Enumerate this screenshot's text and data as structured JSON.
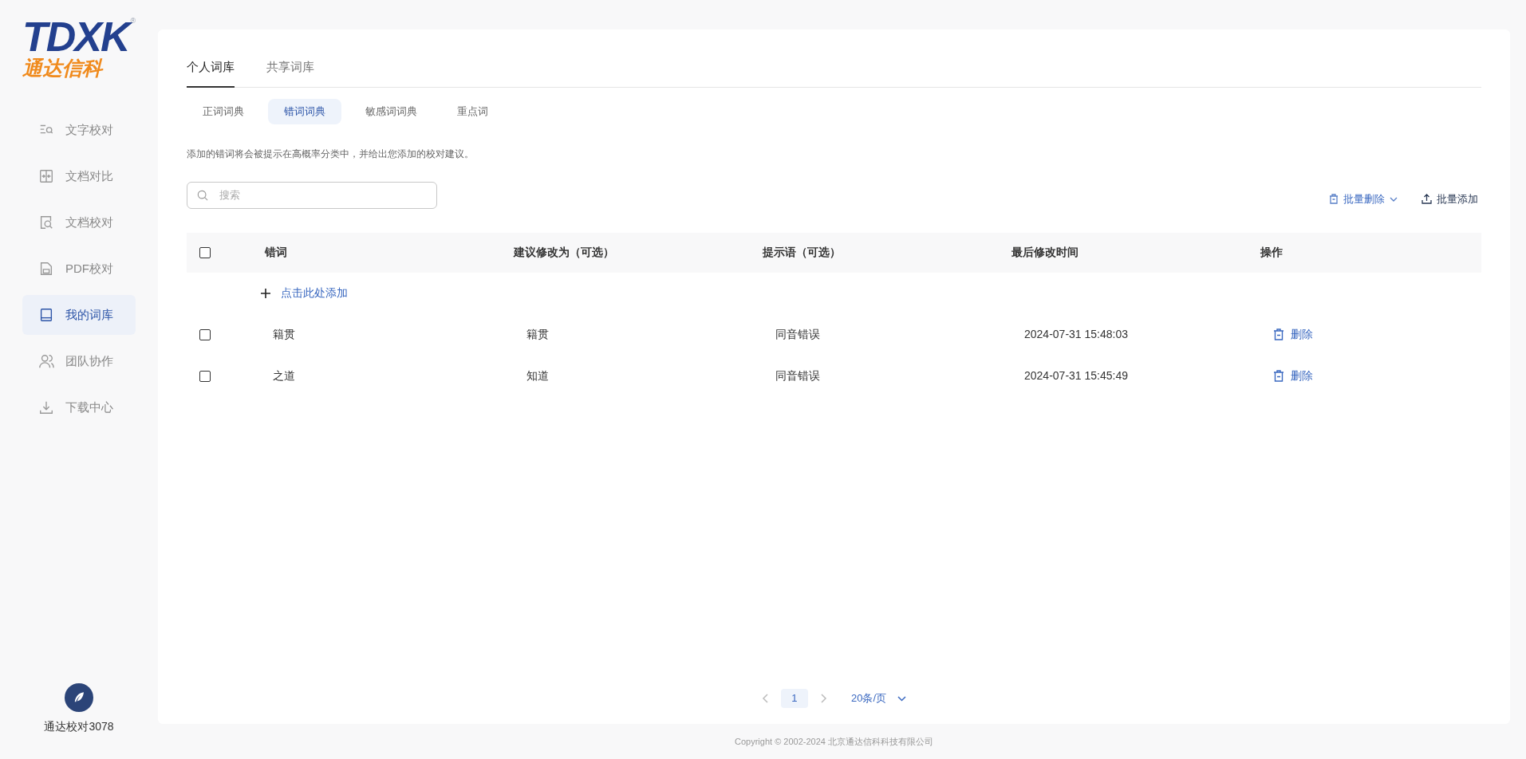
{
  "logo": {
    "mark": "TDXK",
    "registered": "®",
    "name": "通达信科"
  },
  "sidebar": {
    "items": [
      {
        "label": "文字校对",
        "kind": "textcheck",
        "selected": false
      },
      {
        "label": "文档对比",
        "kind": "compare",
        "selected": false
      },
      {
        "label": "文档校对",
        "kind": "doccheck",
        "selected": false
      },
      {
        "label": "PDF校对",
        "kind": "pdf",
        "selected": false
      },
      {
        "label": "我的词库",
        "kind": "library",
        "selected": true
      },
      {
        "label": "团队协作",
        "kind": "team",
        "selected": false
      },
      {
        "label": "下载中心",
        "kind": "download",
        "selected": false
      }
    ],
    "user": {
      "name": "通达校对3078"
    }
  },
  "tabs": [
    {
      "label": "个人词库",
      "selected": true
    },
    {
      "label": "共享词库",
      "selected": false
    }
  ],
  "subtabs": [
    {
      "label": "正词词典",
      "selected": false
    },
    {
      "label": "错词词典",
      "selected": true
    },
    {
      "label": "敏感词词典",
      "selected": false
    },
    {
      "label": "重点词",
      "selected": false
    }
  ],
  "description": "添加的错词将会被提示在高概率分类中，并给出您添加的校对建议。",
  "search": {
    "placeholder": "搜索"
  },
  "actions": [
    {
      "label": "批量删除",
      "kind": "dropdown"
    },
    {
      "label": "批量添加",
      "kind": "upload"
    }
  ],
  "table": {
    "select_all": {
      "checked": false
    },
    "columns": [
      "错词",
      "建议修改为（可选）",
      "提示语（可选）",
      "最后修改时间",
      "操作"
    ],
    "add_row": "点击此处添加",
    "rows": [
      {
        "checked": false,
        "cells": [
          "籍贯",
          "籍贯",
          "同音错误",
          "2024-07-31 15:48:03"
        ],
        "action": "删除"
      },
      {
        "checked": false,
        "cells": [
          "之道",
          "知道",
          "同音错误",
          "2024-07-31 15:45:49"
        ],
        "action": "删除"
      }
    ]
  },
  "pagination": {
    "pages": [
      {
        "label": "1",
        "selected": true
      }
    ],
    "page_size": "20条/页"
  },
  "footer": "Copyright © 2002-2024 北京通达信科科技有限公司"
}
